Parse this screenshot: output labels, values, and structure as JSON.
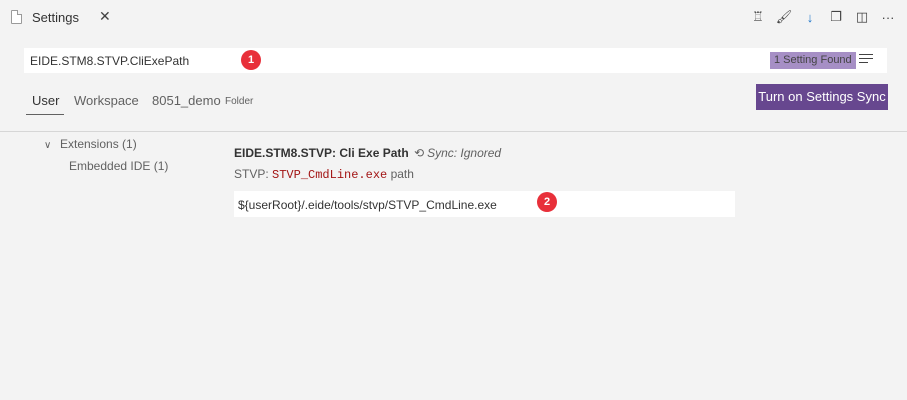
{
  "tab": {
    "title": "Settings",
    "close": "✕"
  },
  "actions": [
    {
      "name": "remote-icon",
      "glyph": "♖"
    },
    {
      "name": "brush-icon",
      "glyph": "🖌"
    },
    {
      "name": "download-icon",
      "glyph": "↓"
    },
    {
      "name": "open-json-icon",
      "glyph": "❐"
    },
    {
      "name": "split-editor-icon",
      "glyph": "◫"
    },
    {
      "name": "more-icon",
      "glyph": "···"
    }
  ],
  "search": {
    "value": "EIDE.STM8.STVP.CliExePath",
    "marker": "1",
    "results": "1 Setting Found"
  },
  "scopes": {
    "user": "User",
    "workspace": "Workspace",
    "folder": "8051_demo",
    "folder_tag": "Folder",
    "sync_button": "Turn on Settings Sync"
  },
  "toc": {
    "extensions": "Extensions (1)",
    "embedded": "Embedded IDE (1)"
  },
  "setting": {
    "category": "EIDE.STM8.STVP: ",
    "name": "Cli Exe Path",
    "sync_icon": "⟲",
    "sync_note": "Sync: Ignored",
    "desc_prefix": "STVP: ",
    "desc_code": "STVP_CmdLine.exe",
    "desc_suffix": " path",
    "value": "${userRoot}/.eide/tools/stvp/STVP_CmdLine.exe",
    "marker": "2"
  },
  "colors": {
    "accent": "#67478f",
    "badge": "#e8303a",
    "found_badge": "#a68fc5"
  }
}
